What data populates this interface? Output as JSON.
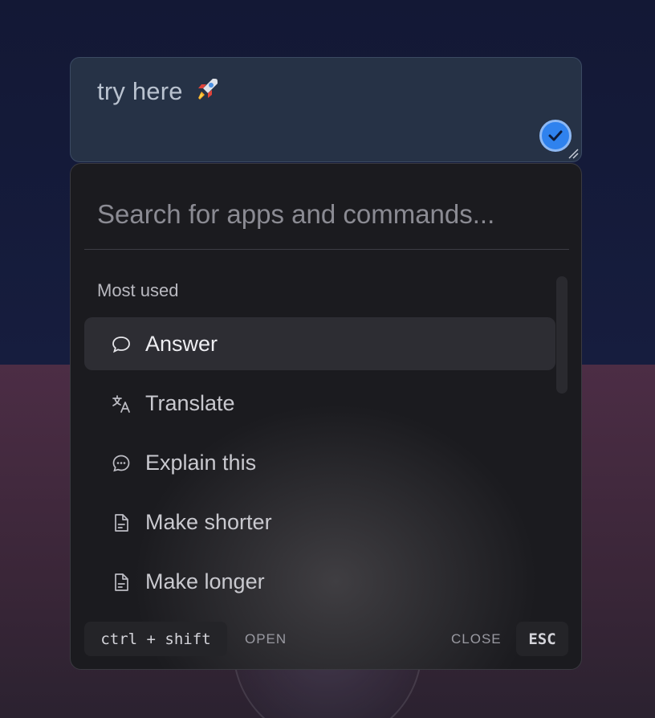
{
  "textarea": {
    "value": "try here",
    "emoji_icon": "rocket-icon",
    "check_color": "#2f82ee"
  },
  "palette": {
    "search_placeholder": "Search for apps and commands...",
    "section_title": "Most used",
    "items": [
      {
        "label": "Answer",
        "icon": "chat-bubble-icon",
        "active": true
      },
      {
        "label": "Translate",
        "icon": "translate-icon",
        "active": false
      },
      {
        "label": "Explain this",
        "icon": "chat-dots-icon",
        "active": false
      },
      {
        "label": "Make shorter",
        "icon": "document-icon",
        "active": false
      },
      {
        "label": "Make longer",
        "icon": "document-icon",
        "active": false
      }
    ],
    "footer": {
      "open_shortcut": "ctrl + shift",
      "open_label": "OPEN",
      "close_label": "CLOSE",
      "close_shortcut": "ESC"
    }
  },
  "colors": {
    "background_top": "#131835",
    "background_bottom": "#4c2d45",
    "palette_bg": "#1b1b1f",
    "active_row": "#2d2d33"
  }
}
